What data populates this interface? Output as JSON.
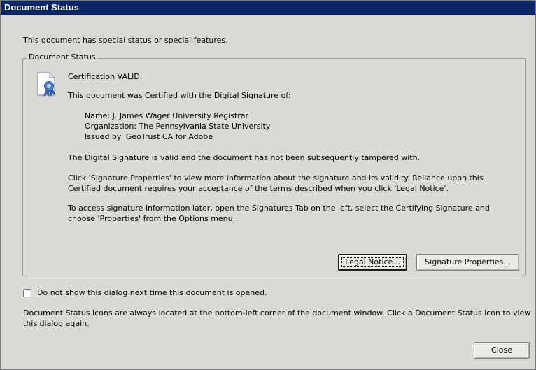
{
  "window": {
    "title": "Document Status"
  },
  "intro_text": "This document has special status or special features.",
  "group": {
    "legend": "Document Status",
    "status": "Certification VALID.",
    "certified_by_intro": "This document was Certified with the Digital Signature of:",
    "name_line": "Name: J. James Wager University Registrar",
    "organization_line": "Organization: The Pennsylvania State University",
    "issuer_line": "Issued by: GeoTrust CA for Adobe",
    "validity_text": "The Digital Signature is valid and the document has not been subsequently tampered with.",
    "properties_info": "Click 'Signature Properties' to view more information about the signature and its validity. Reliance upon this Certified document requires your acceptance of the terms described when you click 'Legal Notice'.",
    "access_info": "To access signature information later, open the Signatures Tab on the left, select the Certifying Signature and choose 'Properties' from the Options menu.",
    "legal_notice_label": "Legal Notice...",
    "signature_properties_label": "Signature Properties..."
  },
  "checkbox": {
    "checked": false,
    "label": "Do not show this dialog next time this document is opened."
  },
  "footer_note": "Document Status icons are always located at the bottom-left corner of the document window. Click a Document Status icon to view this dialog again.",
  "close_label": "Close",
  "icons": {
    "certificate": "certificate-ribbon-icon"
  },
  "colors": {
    "titlebar": "#0a246a",
    "dialog_background": "#dcdad5",
    "icon_ribbon": "#3b6fc9"
  }
}
